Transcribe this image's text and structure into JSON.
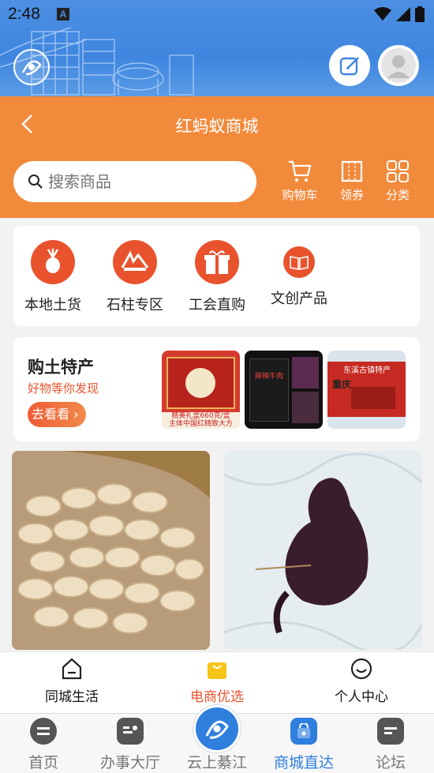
{
  "status_bar": {
    "time": "2:48",
    "notification_icon": "A"
  },
  "header": {
    "title": "红蚂蚁商城",
    "search_placeholder": "搜索商品",
    "actions": [
      {
        "label": "购物车",
        "icon": "cart-icon"
      },
      {
        "label": "领券",
        "icon": "coupon-icon"
      },
      {
        "label": "分类",
        "icon": "grid-icon"
      }
    ]
  },
  "categories": [
    {
      "label": "本地土货",
      "icon": "radish-icon"
    },
    {
      "label": "石柱专区",
      "icon": "shizhu-icon"
    },
    {
      "label": "工会直购",
      "icon": "gift-icon"
    },
    {
      "label": "文创产品",
      "icon": "book-icon"
    }
  ],
  "promo": {
    "title": "购土特产",
    "subtitle": "好物等你发现",
    "button_label": "去看看",
    "images": [
      {
        "caption": "精美礼盒660克/盒",
        "sub": "主体中国红精致大方"
      },
      {
        "caption": "麻辣牛肉"
      },
      {
        "caption": "东溪古镇特产",
        "sub": "重庆"
      }
    ]
  },
  "products": [
    {
      "name": "peanuts"
    },
    {
      "name": "smoked-duck"
    }
  ],
  "inner_tabs": [
    {
      "label": "同城生活",
      "icon": "home-icon",
      "active": false
    },
    {
      "label": "电商优选",
      "icon": "shopping-bag-icon",
      "active": true
    },
    {
      "label": "个人中心",
      "icon": "smile-icon",
      "active": false
    }
  ],
  "bottom_nav": [
    {
      "label": "首页",
      "icon": "home-nav-icon",
      "active": false
    },
    {
      "label": "办事大厅",
      "icon": "hall-icon",
      "active": false
    },
    {
      "label": "云上綦江",
      "icon": "qijiang-logo-icon",
      "active": false
    },
    {
      "label": "商城直达",
      "icon": "mall-bag-icon",
      "active": true
    },
    {
      "label": "论坛",
      "icon": "forum-icon",
      "active": false
    }
  ],
  "colors": {
    "primary_orange": "#f28a3c",
    "accent_red": "#e8532e",
    "header_blue": "#4c8fe3",
    "active_blue": "#2f7fde"
  }
}
